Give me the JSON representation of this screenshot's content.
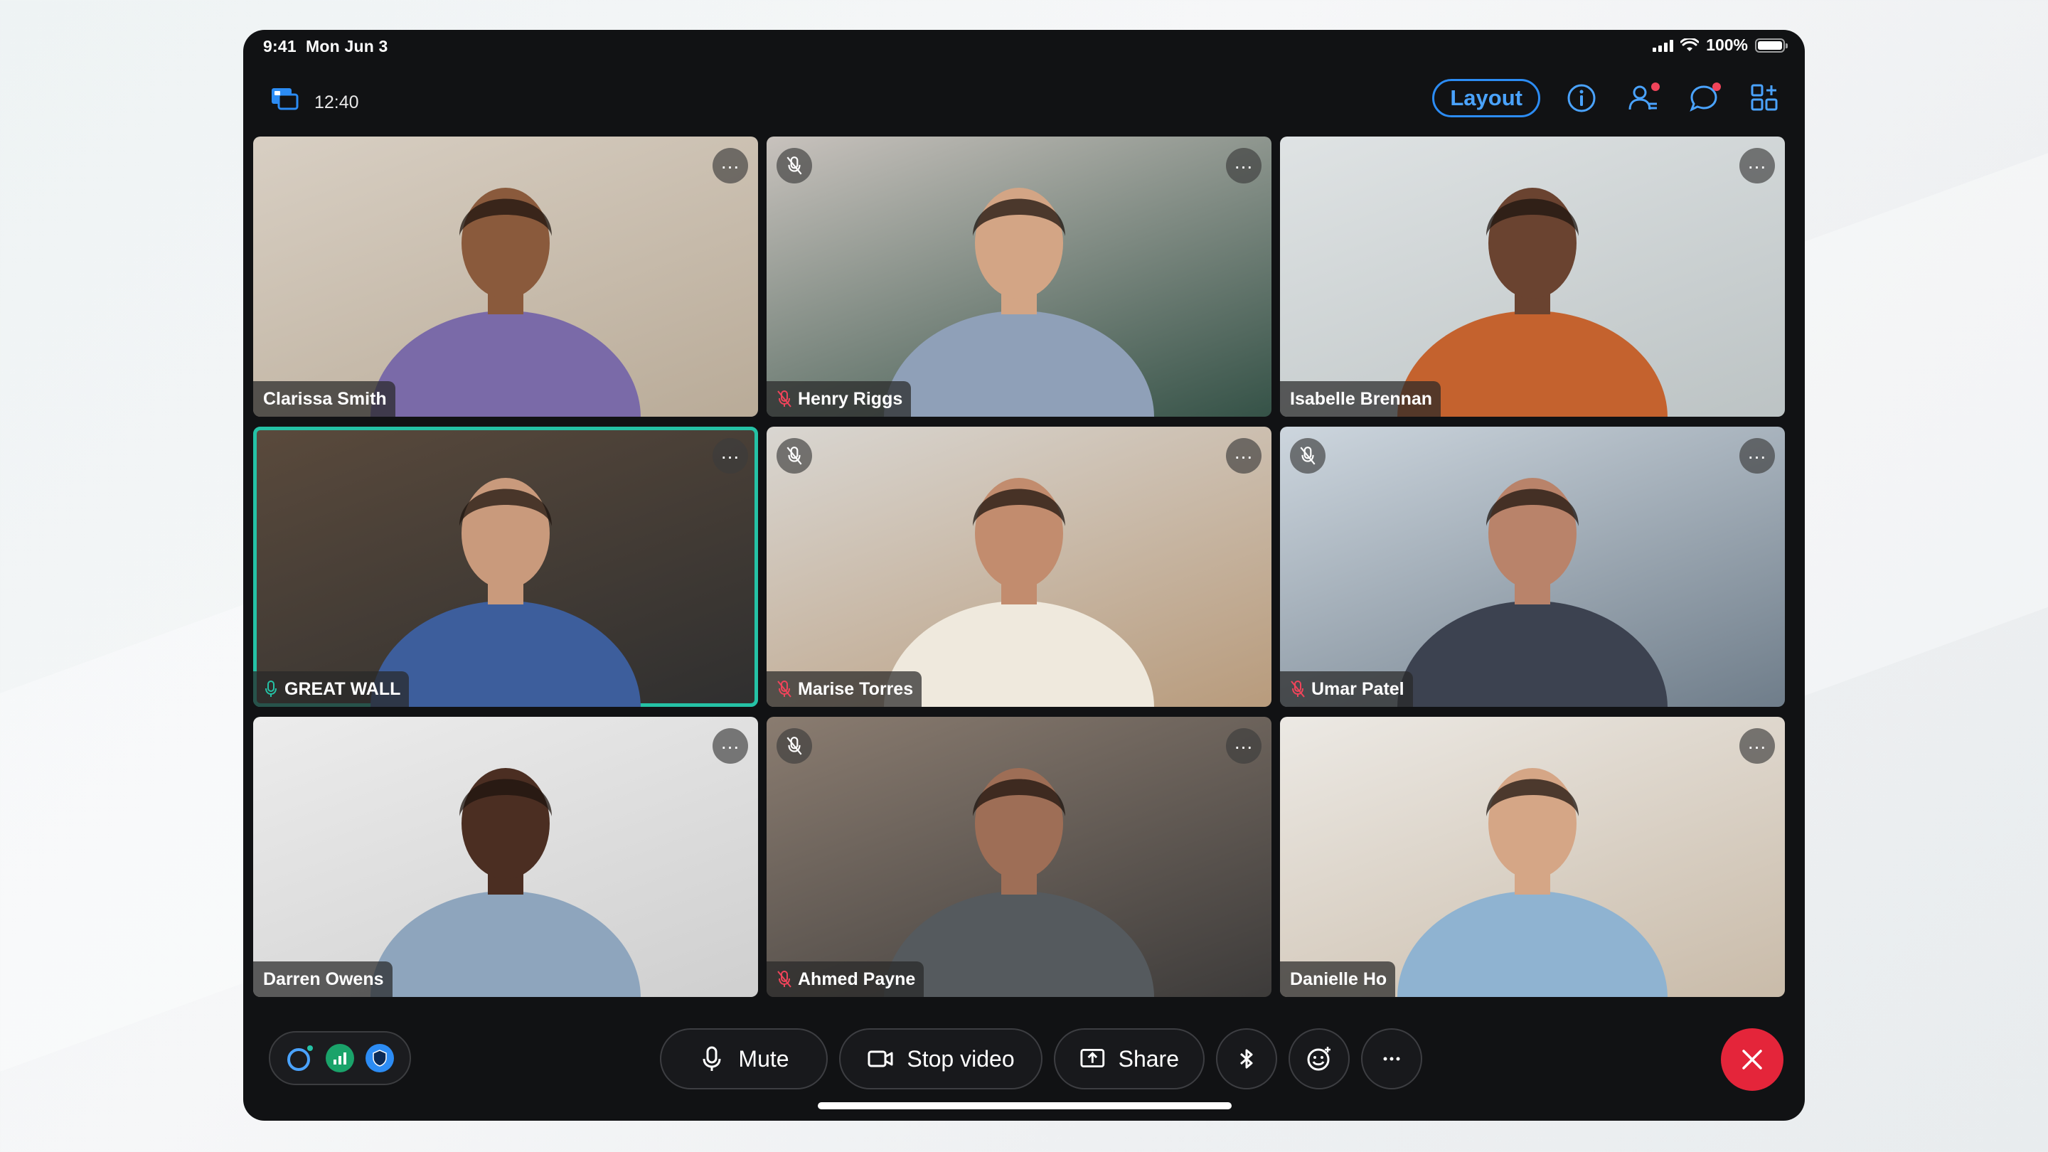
{
  "status_bar": {
    "time": "9:41",
    "date": "Mon Jun 3",
    "battery": "100%"
  },
  "top_bar": {
    "timer": "12:40",
    "layout_label": "Layout"
  },
  "participants": [
    {
      "name": "Clarissa Smith",
      "muted": false,
      "active": false,
      "skin": "#8a5a3c",
      "bg": [
        "#d8cfc3",
        "#b9ab98"
      ],
      "shirt": "#7a6aa8"
    },
    {
      "name": "Henry Riggs",
      "muted": true,
      "active": false,
      "skin": "#d3a585",
      "bg": [
        "#c8c2bd",
        "#355247"
      ],
      "shirt": "#8fa0b8"
    },
    {
      "name": "Isabelle Brennan",
      "muted": false,
      "active": false,
      "skin": "#6a4330",
      "bg": [
        "#dfe3e4",
        "#bcc3c4"
      ],
      "shirt": "#c4622e"
    },
    {
      "name": "GREAT WALL",
      "muted": false,
      "active": true,
      "skin": "#c99a7c",
      "bg": [
        "#5a4a3c",
        "#2f2f2f"
      ],
      "shirt": "#3d5e9c"
    },
    {
      "name": "Marise Torres",
      "muted": true,
      "active": false,
      "skin": "#c28c6e",
      "bg": [
        "#d9d6d1",
        "#b89b7c"
      ],
      "shirt": "#efe9dd"
    },
    {
      "name": "Umar Patel",
      "muted": true,
      "active": false,
      "skin": "#b9836a",
      "bg": [
        "#cdd6de",
        "#6f7d8a"
      ],
      "shirt": "#3c4250"
    },
    {
      "name": "Darren Owens",
      "muted": false,
      "active": false,
      "skin": "#4b2e22",
      "bg": [
        "#ececec",
        "#cfcfcf"
      ],
      "shirt": "#8ea5bd"
    },
    {
      "name": "Ahmed Payne",
      "muted": true,
      "active": false,
      "skin": "#9e6e56",
      "bg": [
        "#8a7c70",
        "#3d3b3a"
      ],
      "shirt": "#555a5e"
    },
    {
      "name": "Danielle Ho",
      "muted": false,
      "active": false,
      "skin": "#d5a686",
      "bg": [
        "#ece9e4",
        "#c9bba9"
      ],
      "shirt": "#8fb3d1"
    }
  ],
  "controls": {
    "mute_label": "Mute",
    "video_label": "Stop video",
    "share_label": "Share"
  },
  "colors": {
    "accent": "#2c8cf4",
    "active_border": "#25c2a6",
    "end_call": "#e4253a",
    "muted_icon": "#f0445a"
  }
}
